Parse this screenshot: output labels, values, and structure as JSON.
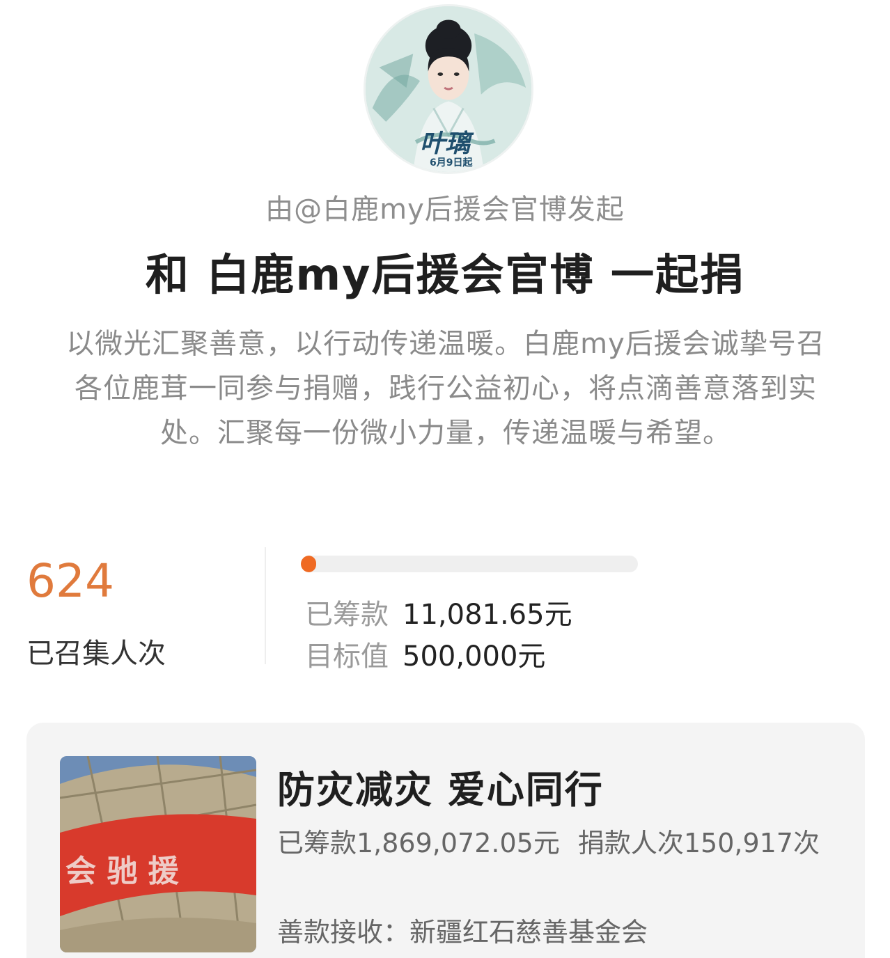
{
  "avatar": {
    "icon": "actress-poster-avatar",
    "poster_text": "叶璃",
    "poster_date": "6月9日起"
  },
  "campaign": {
    "initiator": "由@白鹿my后援会官博发起",
    "title": "和 白鹿my后援会官博 一起捐",
    "description": "以微光汇聚善意，以行动传递温暖。白鹿my后援会诚挚号召各位鹿茸一同参与捐赠，践行公益初心，将点滴善意落到实处。汇聚每一份微小力量，传递温暖与希望。"
  },
  "stats": {
    "count": "624",
    "count_label": "已召集人次",
    "raised_label": "已筹款",
    "raised_value": "11,081.65元",
    "target_label": "目标值",
    "target_value": "500,000元",
    "progress_fraction": 0.022,
    "accent_color": "#e07a3c",
    "progress_color": "#ef6a23"
  },
  "project_card": {
    "thumbnail_icon": "relief-cargo-photo",
    "title": "防灾减灾 爱心同行",
    "raised": "已筹款1,869,072.05元",
    "donors": "捐款人次150,917次",
    "recipient": "善款接收：新疆红石慈善基金会"
  }
}
